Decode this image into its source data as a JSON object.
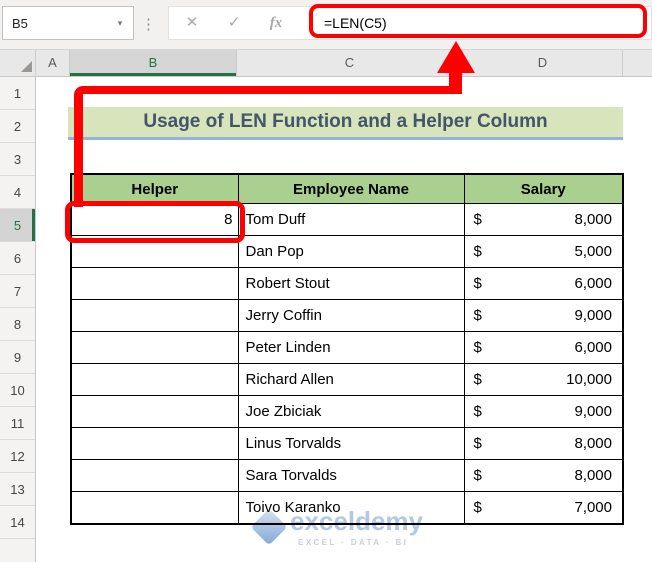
{
  "formula_bar": {
    "name_box": "B5",
    "name_box_dropdown": "▾",
    "dots": "⋮",
    "cancel": "✕",
    "enter": "✓",
    "fx": "fx",
    "formula": "=LEN(C5)"
  },
  "column_headers": {
    "a": "A",
    "b": "B",
    "c": "C",
    "d": "D"
  },
  "selected_column": "B",
  "selected_row": "5",
  "row_headers": [
    "1",
    "2",
    "3",
    "4",
    "5",
    "6",
    "7",
    "8",
    "9",
    "10",
    "11",
    "12",
    "13",
    "14"
  ],
  "banner": {
    "title": "Usage of LEN Function and a Helper Column"
  },
  "table": {
    "headers": {
      "helper": "Helper",
      "name": "Employee Name",
      "salary": "Salary"
    },
    "rows": [
      {
        "helper": "8",
        "name": "Tom Duff",
        "cur": "$",
        "amount": "8,000"
      },
      {
        "helper": "",
        "name": "Dan Pop",
        "cur": "$",
        "amount": "5,000"
      },
      {
        "helper": "",
        "name": "Robert Stout",
        "cur": "$",
        "amount": "6,000"
      },
      {
        "helper": "",
        "name": "Jerry Coffin",
        "cur": "$",
        "amount": "9,000"
      },
      {
        "helper": "",
        "name": "Peter Linden",
        "cur": "$",
        "amount": "6,000"
      },
      {
        "helper": "",
        "name": "Richard Allen",
        "cur": "$",
        "amount": "10,000"
      },
      {
        "helper": "",
        "name": "Joe Zbiciak",
        "cur": "$",
        "amount": "9,000"
      },
      {
        "helper": "",
        "name": "Linus Torvalds",
        "cur": "$",
        "amount": "8,000"
      },
      {
        "helper": "",
        "name": "Sara Torvalds",
        "cur": "$",
        "amount": "8,000"
      },
      {
        "helper": "",
        "name": "Toivo Karanko",
        "cur": "$",
        "amount": "7,000"
      }
    ]
  },
  "watermark": {
    "brand": "exceldemy",
    "tagline": "EXCEL · DATA · BI"
  },
  "colors": {
    "excel_green": "#217346",
    "table_header_fill": "#A9D08E",
    "banner_fill": "#D7E4BC",
    "banner_text": "#44546A",
    "banner_underline": "#95B3D7",
    "annotation_red": "#FE0000",
    "watermark_blue": "#B3C8E6"
  }
}
